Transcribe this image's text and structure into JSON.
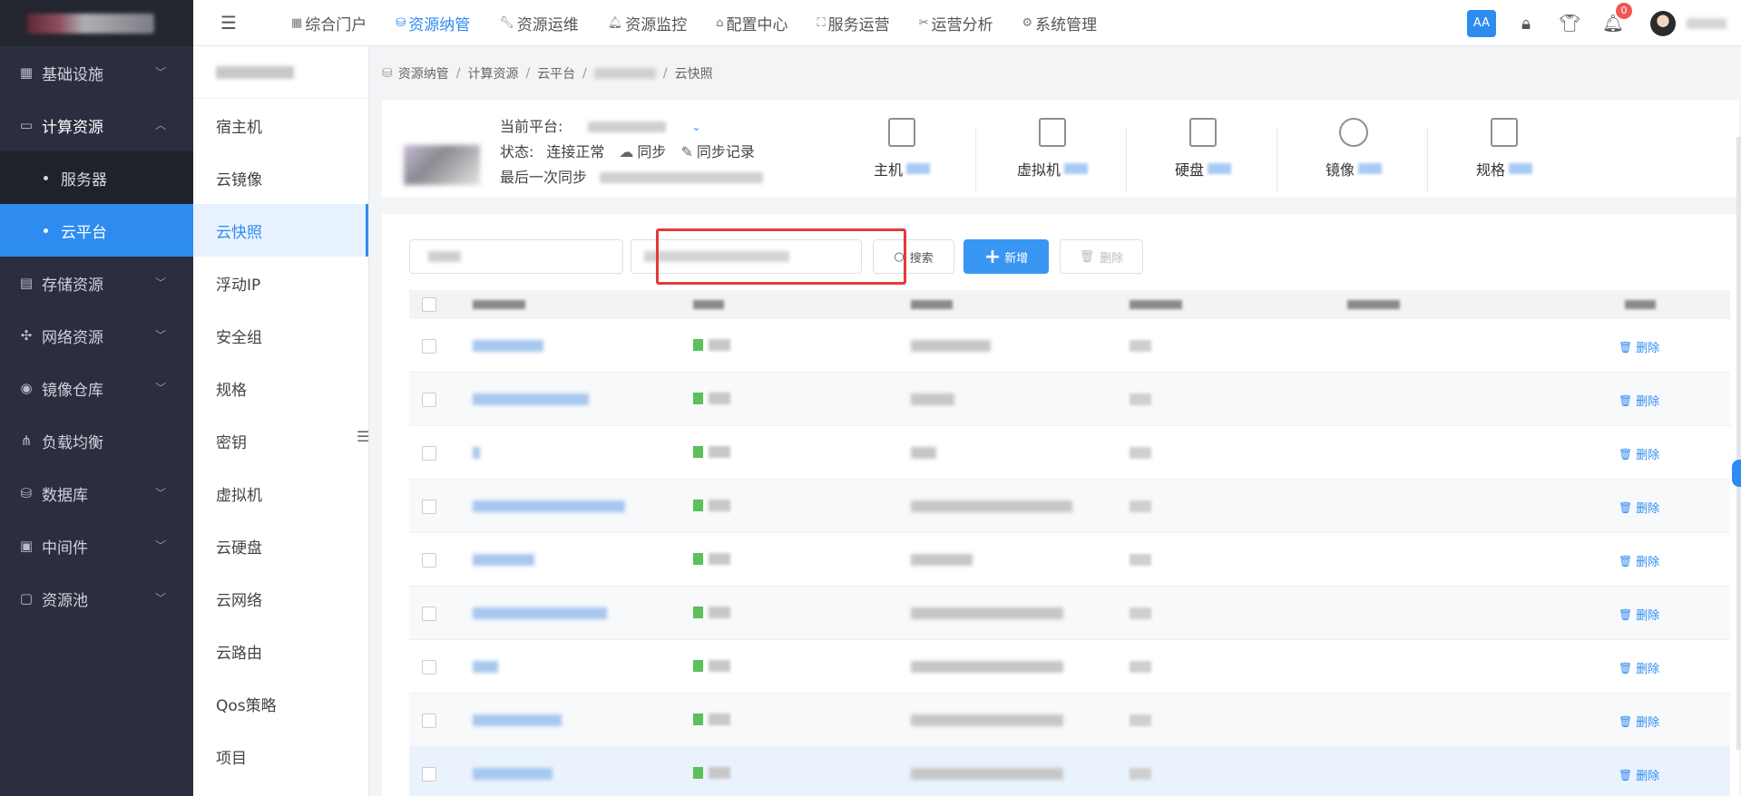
{
  "sidebar": {
    "items": [
      {
        "label": "基础设施",
        "icon": "grid-icon",
        "expanded": false
      },
      {
        "label": "计算资源",
        "icon": "monitor-icon",
        "expanded": true,
        "children": [
          {
            "label": "服务器",
            "active": false
          },
          {
            "label": "云平台",
            "active": true
          }
        ]
      },
      {
        "label": "存储资源",
        "icon": "storage-icon",
        "expanded": false
      },
      {
        "label": "网络资源",
        "icon": "network-icon",
        "expanded": false
      },
      {
        "label": "镜像仓库",
        "icon": "image-repo-icon",
        "expanded": false
      },
      {
        "label": "负载均衡",
        "icon": "load-balance-icon",
        "expanded": null
      },
      {
        "label": "数据库",
        "icon": "database-icon",
        "expanded": false
      },
      {
        "label": "中间件",
        "icon": "middleware-icon",
        "expanded": false
      },
      {
        "label": "资源池",
        "icon": "resource-pool-icon",
        "expanded": false
      }
    ]
  },
  "topnav": {
    "items": [
      {
        "label": "综合门户",
        "icon": "grid-icon",
        "active": false
      },
      {
        "label": "资源纳管",
        "icon": "database-icon",
        "active": true
      },
      {
        "label": "资源运维",
        "icon": "wrench-icon",
        "active": false
      },
      {
        "label": "资源监控",
        "icon": "bell-icon",
        "active": false
      },
      {
        "label": "配置中心",
        "icon": "home-icon",
        "active": false
      },
      {
        "label": "服务运营",
        "icon": "org-icon",
        "active": false
      },
      {
        "label": "运营分析",
        "icon": "scissors-icon",
        "active": false
      },
      {
        "label": "系统管理",
        "icon": "gear-icon",
        "active": false
      }
    ],
    "font_size_btn": "AA",
    "notification_count": "0"
  },
  "secondary_menu": {
    "items": [
      "宿主机",
      "云镜像",
      "云快照",
      "浮动IP",
      "安全组",
      "规格",
      "密钥",
      "虚拟机",
      "云硬盘",
      "云网络",
      "云路由",
      "Qos策略",
      "项目"
    ],
    "active": "云快照"
  },
  "breadcrumb": [
    "资源纳管",
    "计算资源",
    "云平台",
    "云快照"
  ],
  "platform": {
    "current_label": "当前平台:",
    "status_label": "状态:",
    "status_value": "连接正常",
    "sync_label": "同步",
    "sync_record_label": "同步记录",
    "last_sync_label": "最后一次同步",
    "stats": [
      {
        "label": "主机",
        "icon": "server-icon"
      },
      {
        "label": "虚拟机",
        "icon": "vm-icon"
      },
      {
        "label": "硬盘",
        "icon": "disk-icon"
      },
      {
        "label": "镜像",
        "icon": "image-icon"
      },
      {
        "label": "规格",
        "icon": "spec-icon"
      }
    ]
  },
  "toolbar": {
    "search_label": "搜索",
    "add_label": "新增",
    "delete_label": "删除"
  },
  "table": {
    "row_action": "删除",
    "rows": [
      {
        "name_w": 78,
        "c3_w": 88
      },
      {
        "name_w": 128,
        "c3_w": 48
      },
      {
        "name_w": 8,
        "c3_w": 28
      },
      {
        "name_w": 168,
        "c3_w": 178
      },
      {
        "name_w": 68,
        "c3_w": 68
      },
      {
        "name_w": 148,
        "c3_w": 168
      },
      {
        "name_w": 28,
        "c3_w": 168
      },
      {
        "name_w": 98,
        "c3_w": 168
      },
      {
        "name_w": 88,
        "c3_w": 168
      }
    ]
  }
}
